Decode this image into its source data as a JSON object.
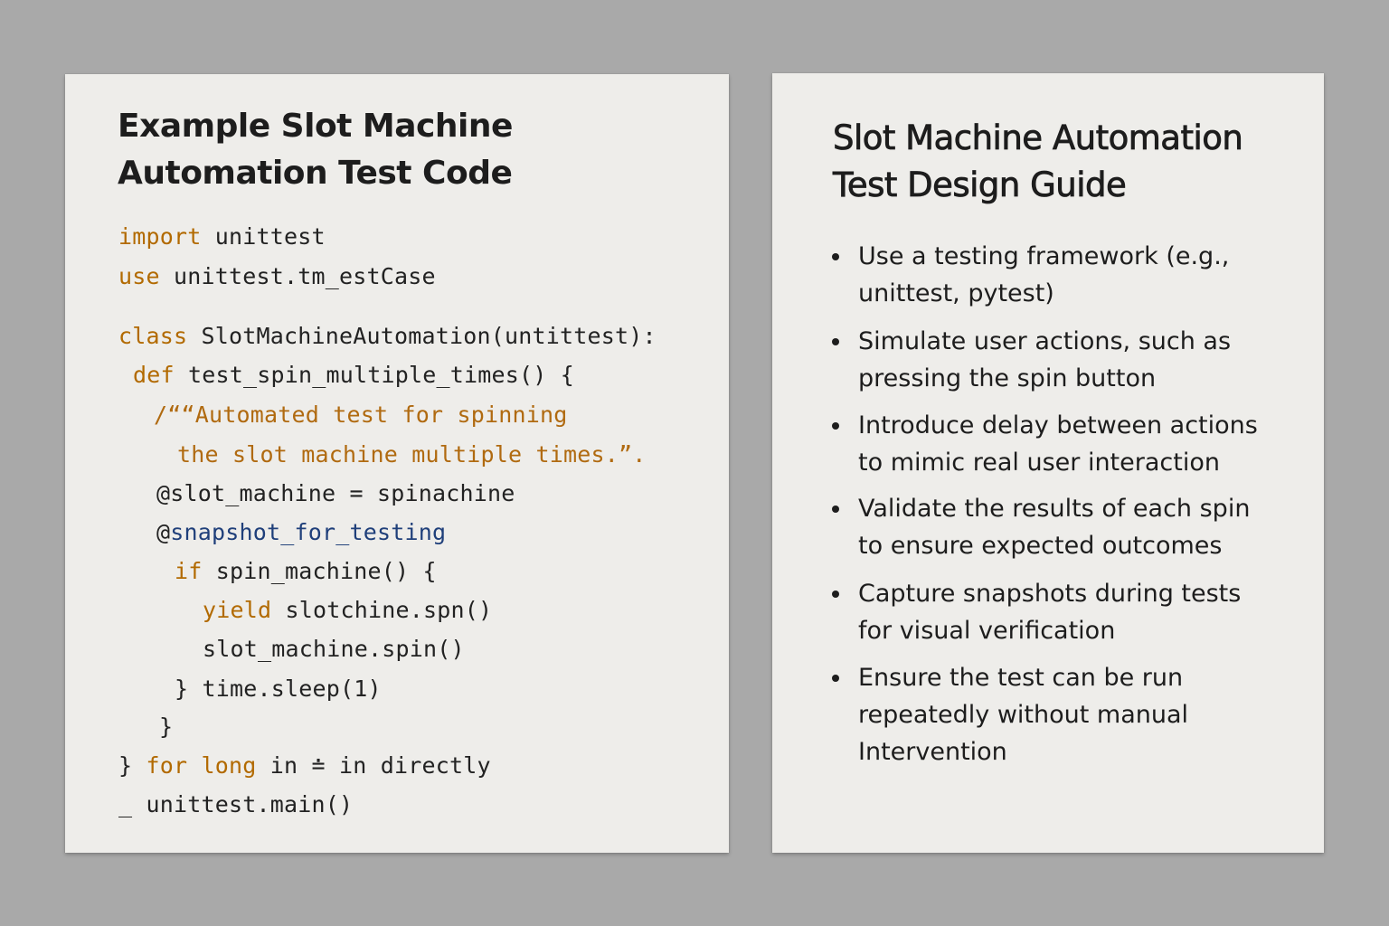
{
  "code_card": {
    "title_line1": "Example Slot Machine",
    "title_line2": "Automation Test Code",
    "lines": [
      {
        "segments": [
          {
            "t": "import",
            "c": "kw"
          },
          {
            "t": " unittest",
            "c": "plain"
          }
        ]
      },
      {
        "segments": [
          {
            "t": "use",
            "c": "kw"
          },
          {
            "t": " unittest.tm_estCase",
            "c": "plain"
          }
        ]
      },
      {
        "segments": [
          {
            "t": "class",
            "c": "kw"
          },
          {
            "t": " SlotMachineAutomation(untittest):",
            "c": "plain"
          }
        ]
      },
      {
        "segments": [
          {
            "t": "def",
            "c": "kw"
          },
          {
            "t": " test_spin_multiple_times() {",
            "c": "plain"
          }
        ]
      },
      {
        "segments": [
          {
            "t": "/““Automated test for spinning",
            "c": "str"
          }
        ]
      },
      {
        "segments": [
          {
            "t": "the slot machine multiple times.”.",
            "c": "str"
          }
        ]
      },
      {
        "segments": [
          {
            "t": "@slot_machine = spinachine",
            "c": "plain"
          }
        ]
      },
      {
        "segments": [
          {
            "t": "@",
            "c": "plain"
          },
          {
            "t": "snapshot_for_testing",
            "c": "dec"
          }
        ]
      },
      {
        "segments": [
          {
            "t": "if",
            "c": "kw"
          },
          {
            "t": " spin_machine() {",
            "c": "plain"
          }
        ]
      },
      {
        "segments": [
          {
            "t": "yield",
            "c": "kw"
          },
          {
            "t": " slotchine.spn()",
            "c": "plain"
          }
        ]
      },
      {
        "segments": [
          {
            "t": "slot_machine.spin()",
            "c": "plain"
          }
        ]
      },
      {
        "segments": [
          {
            "t": "} time.sleep(1)",
            "c": "plain"
          }
        ]
      },
      {
        "segments": [
          {
            "t": "}",
            "c": "plain"
          }
        ]
      },
      {
        "segments": [
          {
            "t": "} ",
            "c": "plain"
          },
          {
            "t": "for long",
            "c": "kw"
          },
          {
            "t": " in ≐ in directly",
            "c": "plain"
          }
        ]
      },
      {
        "segments": [
          {
            "t": "_ unittest.main()",
            "c": "plain"
          }
        ]
      }
    ]
  },
  "guide_card": {
    "title_line1": "Slot Machine Automation",
    "title_line2": "Test Design Guide",
    "items": [
      "Use a testing framework (e.g.,\nunittest, pytest)",
      "Simulate user actions, such as\npressing the spin button",
      "Introduce delay between actions\nto mimic real user interaction",
      "Validate the results of each spin\nto ensure expected outcomes",
      "Capture snapshots during tests\nfor visual verification",
      "Ensure the test can be run\nrepeatedly without manual\nIntervention"
    ]
  }
}
